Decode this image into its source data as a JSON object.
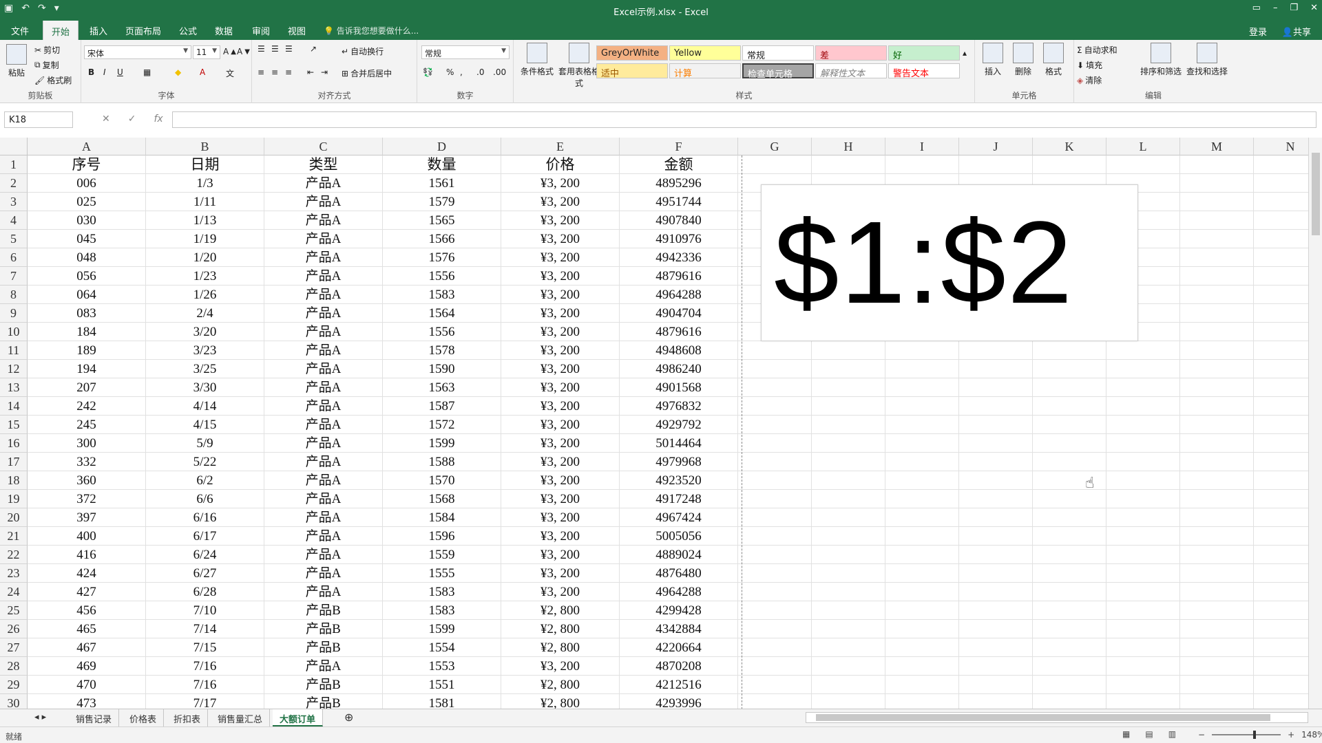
{
  "window": {
    "title": "Excel示例.xlsx - Excel"
  },
  "tabs": {
    "items": [
      "文件",
      "开始",
      "插入",
      "页面布局",
      "公式",
      "数据",
      "审阅",
      "视图"
    ],
    "active": "开始",
    "tellme": "告诉我您想要做什么...",
    "login": "登录",
    "share": "共享"
  },
  "ribbon": {
    "clipboard": {
      "label": "剪贴板",
      "paste": "粘贴",
      "cut": "剪切",
      "copy": "复制",
      "format_painter": "格式刷"
    },
    "font": {
      "label": "字体",
      "name": "宋体",
      "size": "11"
    },
    "alignment": {
      "label": "对齐方式",
      "wrap": "自动换行",
      "merge": "合并后居中"
    },
    "number": {
      "label": "数字",
      "format": "常规"
    },
    "styles": {
      "label": "样式",
      "conditional": "条件格式",
      "table": "套用表格格式",
      "cells": [
        "GreyOrWhite",
        "Yellow",
        "常规",
        "差",
        "好",
        "适中",
        "计算",
        "检查单元格",
        "解释性文本",
        "警告文本"
      ]
    },
    "cellsgroup": {
      "label": "单元格",
      "insert": "插入",
      "delete": "删除",
      "format": "格式"
    },
    "editing": {
      "label": "编辑",
      "autosum": "自动求和",
      "fill": "填充",
      "clear": "清除",
      "sort": "排序和筛选",
      "find": "查找和选择"
    }
  },
  "formula_bar": {
    "name_box": "K18",
    "fx": "fx",
    "value": ""
  },
  "columns": [
    "A",
    "B",
    "C",
    "D",
    "E",
    "F",
    "G",
    "H",
    "I",
    "J",
    "K",
    "L",
    "M",
    "N"
  ],
  "table": {
    "headers": [
      "序号",
      "日期",
      "类型",
      "数量",
      "价格",
      "金额"
    ],
    "rows": [
      [
        "006",
        "1/3",
        "产品A",
        "1561",
        "¥3, 200",
        "4895296"
      ],
      [
        "025",
        "1/11",
        "产品A",
        "1579",
        "¥3, 200",
        "4951744"
      ],
      [
        "030",
        "1/13",
        "产品A",
        "1565",
        "¥3, 200",
        "4907840"
      ],
      [
        "045",
        "1/19",
        "产品A",
        "1566",
        "¥3, 200",
        "4910976"
      ],
      [
        "048",
        "1/20",
        "产品A",
        "1576",
        "¥3, 200",
        "4942336"
      ],
      [
        "056",
        "1/23",
        "产品A",
        "1556",
        "¥3, 200",
        "4879616"
      ],
      [
        "064",
        "1/26",
        "产品A",
        "1583",
        "¥3, 200",
        "4964288"
      ],
      [
        "083",
        "2/4",
        "产品A",
        "1564",
        "¥3, 200",
        "4904704"
      ],
      [
        "184",
        "3/20",
        "产品A",
        "1556",
        "¥3, 200",
        "4879616"
      ],
      [
        "189",
        "3/23",
        "产品A",
        "1578",
        "¥3, 200",
        "4948608"
      ],
      [
        "194",
        "3/25",
        "产品A",
        "1590",
        "¥3, 200",
        "4986240"
      ],
      [
        "207",
        "3/30",
        "产品A",
        "1563",
        "¥3, 200",
        "4901568"
      ],
      [
        "242",
        "4/14",
        "产品A",
        "1587",
        "¥3, 200",
        "4976832"
      ],
      [
        "245",
        "4/15",
        "产品A",
        "1572",
        "¥3, 200",
        "4929792"
      ],
      [
        "300",
        "5/9",
        "产品A",
        "1599",
        "¥3, 200",
        "5014464"
      ],
      [
        "332",
        "5/22",
        "产品A",
        "1588",
        "¥3, 200",
        "4979968"
      ],
      [
        "360",
        "6/2",
        "产品A",
        "1570",
        "¥3, 200",
        "4923520"
      ],
      [
        "372",
        "6/6",
        "产品A",
        "1568",
        "¥3, 200",
        "4917248"
      ],
      [
        "397",
        "6/16",
        "产品A",
        "1584",
        "¥3, 200",
        "4967424"
      ],
      [
        "400",
        "6/17",
        "产品A",
        "1596",
        "¥3, 200",
        "5005056"
      ],
      [
        "416",
        "6/24",
        "产品A",
        "1559",
        "¥3, 200",
        "4889024"
      ],
      [
        "424",
        "6/27",
        "产品A",
        "1555",
        "¥3, 200",
        "4876480"
      ],
      [
        "427",
        "6/28",
        "产品A",
        "1583",
        "¥3, 200",
        "4964288"
      ],
      [
        "456",
        "7/10",
        "产品B",
        "1583",
        "¥2, 800",
        "4299428"
      ],
      [
        "465",
        "7/14",
        "产品B",
        "1599",
        "¥2, 800",
        "4342884"
      ],
      [
        "467",
        "7/15",
        "产品B",
        "1554",
        "¥2, 800",
        "4220664"
      ],
      [
        "469",
        "7/16",
        "产品A",
        "1553",
        "¥3, 200",
        "4870208"
      ],
      [
        "470",
        "7/16",
        "产品B",
        "1551",
        "¥2, 800",
        "4212516"
      ],
      [
        "473",
        "7/17",
        "产品B",
        "1581",
        "¥2, 800",
        "4293996"
      ]
    ]
  },
  "textbox": "$1:$2",
  "sheets": {
    "tabs": [
      "销售记录",
      "价格表",
      "折扣表",
      "销售量汇总",
      "大额订单"
    ],
    "active": "大额订单",
    "add": "⊕"
  },
  "status": {
    "ready": "就绪",
    "zoom": "148%"
  },
  "colors": {
    "brand": "#217346",
    "ribbon_bg": "#f3f3f3"
  }
}
